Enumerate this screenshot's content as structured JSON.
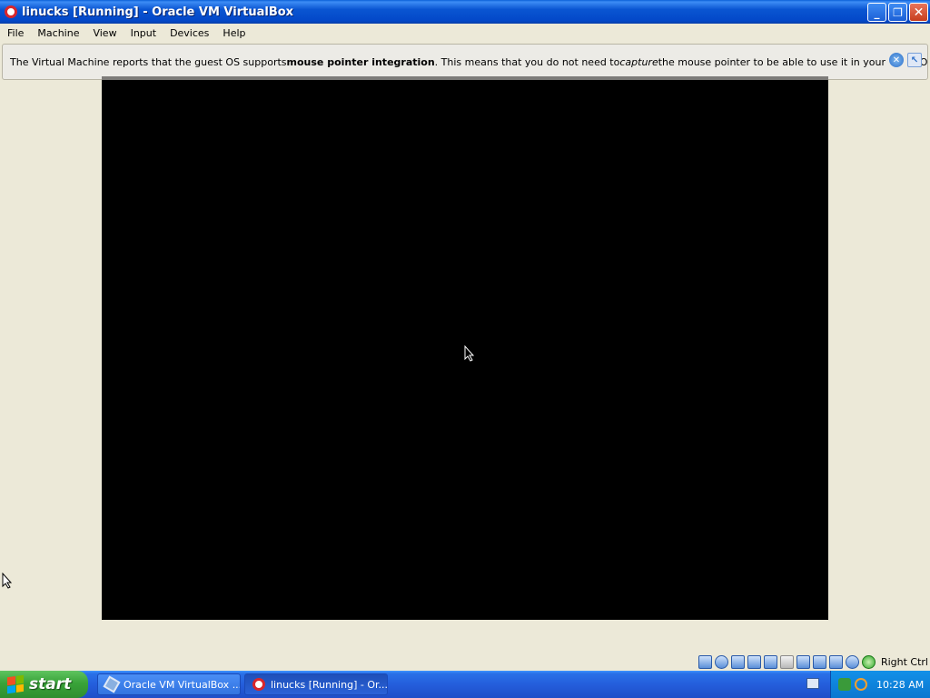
{
  "window": {
    "title": "linucks [Running] - Oracle VM VirtualBox",
    "minimize_icon": "minimize-icon",
    "restore_icon": "restore-icon",
    "close_icon": "close-icon"
  },
  "menu": {
    "items": [
      "File",
      "Machine",
      "View",
      "Input",
      "Devices",
      "Help"
    ]
  },
  "notice": {
    "text_before": "The Virtual Machine reports that the guest OS supports ",
    "bold": "mouse pointer integration",
    "text_mid": ". This means that you do not need to ",
    "italic": "capture",
    "text_after": " the mouse pointer to be able to use it in your guest OS -- all mouse"
  },
  "statusbar": {
    "icons": [
      "hard-disk-icon",
      "optical-drive-icon",
      "audio-icon",
      "network-icon",
      "usb-icon",
      "shared-folders-icon",
      "display-icon",
      "video-capture-icon",
      "cpu-icon",
      "mouse-integration-icon",
      "host-key-icon"
    ],
    "host_key": "Right Ctrl"
  },
  "taskbar": {
    "start_label": "start",
    "tasks": [
      {
        "label": "Oracle VM VirtualBox ...",
        "icon": "virtualbox-icon"
      },
      {
        "label": "linucks [Running] - Or...",
        "icon": "debian-swirl-icon"
      }
    ],
    "clock": "10:28 AM"
  },
  "colors": {
    "titlebar": "#0348c8",
    "taskbar": "#245edc",
    "start_button": "#39a339",
    "vm_screen": "#000000",
    "window_bg": "#ece9d8"
  }
}
